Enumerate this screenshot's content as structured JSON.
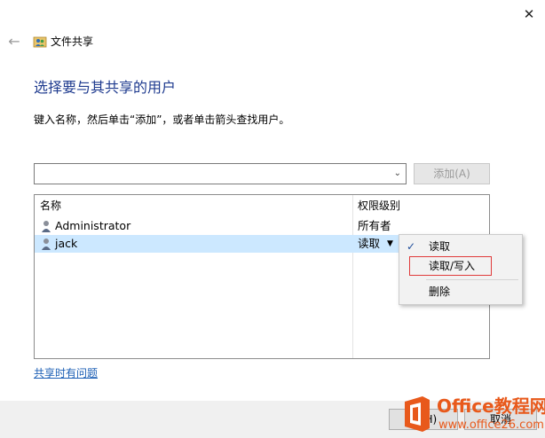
{
  "window": {
    "title": "文件共享",
    "close_glyph": "✕"
  },
  "nav": {
    "back_glyph": "←"
  },
  "main": {
    "heading": "选择要与其共享的用户",
    "instruction": "键入名称，然后单击“添加”，或者单击箭头查找用户。",
    "combo_value": "",
    "add_button": "添加(A)",
    "link": "共享时有问题"
  },
  "list": {
    "col_name": "名称",
    "col_permission": "权限级别",
    "rows": [
      {
        "name": "Administrator",
        "permission": "所有者"
      },
      {
        "name": "jack",
        "permission": "读取"
      }
    ]
  },
  "menu": {
    "items": [
      "读取",
      "读取/写入",
      "删除"
    ],
    "checked": "读取"
  },
  "footer": {
    "share_button": "享(H)",
    "cancel_button": "取消"
  },
  "watermark": {
    "line1": "Office教程网",
    "line2": "www.office26.com"
  },
  "colors": {
    "heading": "#1f3b8f",
    "selection": "#cce8ff",
    "link": "#1c5fb5",
    "highlight_border": "#e03a3a",
    "watermark": "#e8591b"
  },
  "icons": {
    "user": "user-icon",
    "share_title": "share-users-icon",
    "check": "check-icon"
  }
}
